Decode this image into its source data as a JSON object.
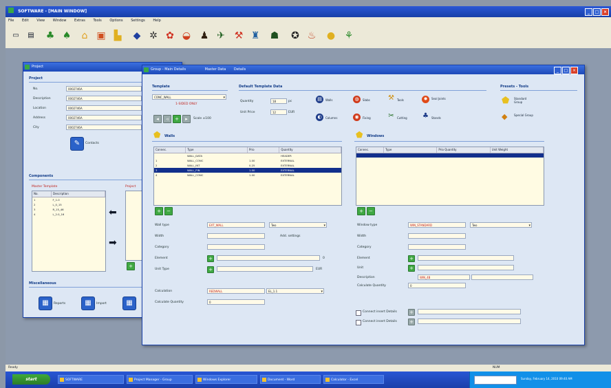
{
  "app": {
    "title": "SOFTWARE - [MAIN WINDOW]"
  },
  "menu": [
    "File",
    "Edit",
    "View",
    "Window",
    "Extras",
    "Tools",
    "Options",
    "Settings",
    "Help"
  ],
  "toolbar": {
    "icons": [
      "new-icon",
      "open-icon",
      "tree-icon",
      "tree-icon",
      "house-icon",
      "shop-icon",
      "factory-icon",
      "truck-icon",
      "mill-icon",
      "flower-icon",
      "hat-icon",
      "person-icon",
      "machine-icon",
      "shovel-icon",
      "fuel-icon",
      "chart-icon",
      "star-icon",
      "bottle-icon"
    ]
  },
  "project_window": {
    "title": "Project",
    "section_project": "Project",
    "fields": [
      {
        "label": "No.",
        "value": "0002746A"
      },
      {
        "label": "Description",
        "value": "0002746A"
      },
      {
        "label": "Location",
        "value": "0002746A"
      },
      {
        "label": "Address",
        "value": "0002746A"
      },
      {
        "label": "City",
        "value": "0002746A"
      }
    ],
    "contacts_button": "Contacts",
    "section_components": "Components",
    "list_left_title": "Master Template",
    "list_right_title": "Project",
    "list_headers": [
      "No.",
      "Description"
    ],
    "list_rows": [
      {
        "no": "1",
        "desc": "F_1.0"
      },
      {
        "no": "2",
        "desc": "L_0_15"
      },
      {
        "no": "3",
        "desc": "R_15_46"
      },
      {
        "no": "4",
        "desc": "L_2.0_16"
      }
    ],
    "section_misc": "Miscellaneous",
    "misc_buttons": [
      "Reports",
      "Import",
      "Export"
    ]
  },
  "detail_window": {
    "title": "Group - Main Details",
    "tabs": [
      "Master Data",
      "Details"
    ],
    "section_template": "Template",
    "template_value": "CONC_WALL",
    "template_note": "1-SIDED ONLY",
    "scale_label": "Scale ±100",
    "section_default": "Default Template Data",
    "qty_label": "Quantity",
    "qty_value": "18",
    "qty_unit": "pc",
    "price_label": "Unit Price",
    "price_value": "12",
    "price_unit": "EUR",
    "cat_buttons": [
      {
        "label": "Walls",
        "icon": "wall-icon"
      },
      {
        "label": "Slabs",
        "icon": "slab-icon"
      },
      {
        "label": "Tools",
        "icon": "tool-icon"
      },
      {
        "label": "Seal Joints",
        "icon": "seal-icon"
      },
      {
        "label": "Columns",
        "icon": "column-icon"
      },
      {
        "label": "Fixing",
        "icon": "fixing-icon"
      },
      {
        "label": "Cutting",
        "icon": "cutting-icon"
      },
      {
        "label": "Stands",
        "icon": "stand-icon"
      }
    ],
    "section_presets": "Presets - Tools",
    "preset_buttons": [
      "Standard Group",
      "Special Group"
    ],
    "section_walls": "Walls",
    "walls_headers": [
      "Connec.",
      "Type",
      "Prio",
      "Quantity"
    ],
    "walls_rows": [
      {
        "c1": "",
        "c2": "WALL_DATA",
        "c3": "",
        "c4": "HEADER"
      },
      {
        "c1": "1",
        "c2": "WALL_CONC",
        "c3": "1.00",
        "c4": "EXTERNAL"
      },
      {
        "c1": "2",
        "c2": "WALL_INT",
        "c3": "0.25",
        "c4": "EXTERNAL"
      },
      {
        "c1": "3",
        "c2": "WALL_FIN",
        "c3": "1.00",
        "c4": "EXTERNAL"
      },
      {
        "c1": "4",
        "c2": "WALL_CONC",
        "c3": "1.00",
        "c4": "EXTERNAL"
      }
    ],
    "section_windows": "Windows",
    "win_headers": [
      "Connec.",
      "Type",
      "Prio Quantity",
      "Unit Weight"
    ],
    "left_form": [
      {
        "label": "Wall type",
        "value": "EXT_WALL",
        "extra": "Two"
      },
      {
        "label": "Width",
        "value": "",
        "extra": "Add. settings"
      },
      {
        "label": "Category",
        "value": ""
      },
      {
        "label": "Element",
        "value": "",
        "extra": "0"
      },
      {
        "label": "Unit Type",
        "value": "",
        "extra": "EUR"
      },
      {
        "label": "Calculation",
        "value": "REDWALL",
        "extra": "EL_1.1"
      },
      {
        "label": "Calculate Quantity",
        "value": "0"
      }
    ],
    "right_form": [
      {
        "label": "Window type",
        "value": "WIN_STANDARD",
        "extra": "Two"
      },
      {
        "label": "Width",
        "value": ""
      },
      {
        "label": "Category",
        "value": ""
      },
      {
        "label": "Element",
        "value": ""
      },
      {
        "label": "Unit",
        "value": ""
      },
      {
        "label": "Description",
        "value": "WIN_4B"
      },
      {
        "label": "Calculate Quantity",
        "value": "0"
      }
    ],
    "check_rows": [
      "Connect insert Details",
      "Connect insert Details"
    ]
  },
  "status": {
    "left": "Ready",
    "right": "NUM"
  },
  "taskbar": {
    "start": "start",
    "tasks": [
      "SOFTWARE",
      "Project Manager - Group",
      "Windows Explorer",
      "Document - Word",
      "Calculator - Excel"
    ],
    "tray": "Sunday, February 14, 2010 09:40 AM"
  }
}
